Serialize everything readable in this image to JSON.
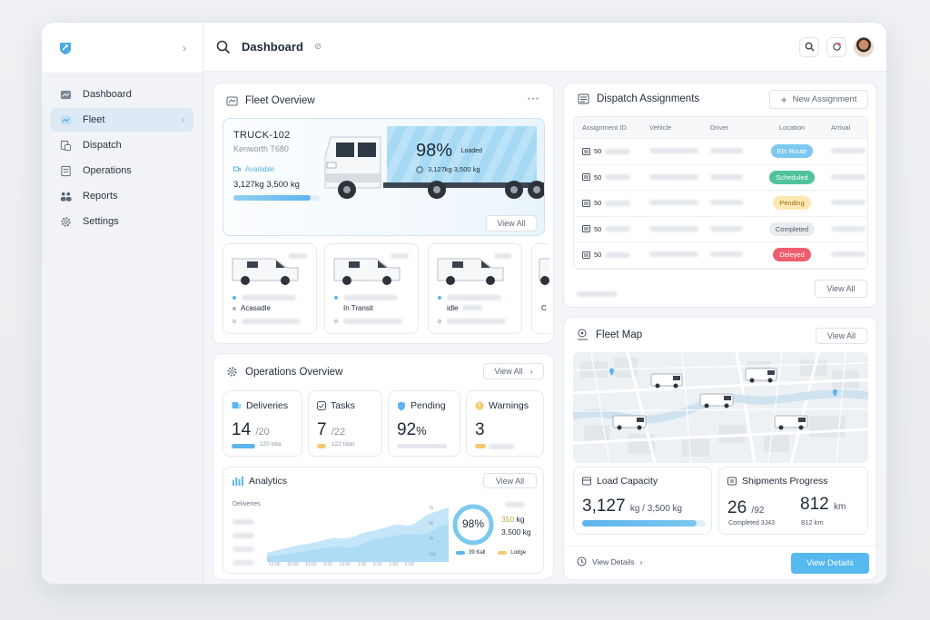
{
  "app": {
    "title": "Dashboard"
  },
  "sidebar": {
    "items": [
      {
        "label": "Dashboard",
        "icon": "dashboard-icon"
      },
      {
        "label": "Fleet",
        "icon": "fleet-icon",
        "active": true
      },
      {
        "label": "Dispatch",
        "icon": "dispatch-icon"
      },
      {
        "label": "Operations",
        "icon": "operations-icon"
      },
      {
        "label": "Reports",
        "icon": "reports-icon"
      },
      {
        "label": "Settings",
        "icon": "gear-icon"
      }
    ]
  },
  "fleet_overview": {
    "title": "Fleet Overview",
    "hero": {
      "truck_id": "TRUCK-102",
      "model": "Kenworth T680",
      "status": "Available",
      "capacity": "3,127kg 3,500 kg",
      "load_percent": "98%",
      "load_label": "Loaded",
      "load_capacity": "3,127kg 3,500 kg",
      "view_all": "View All",
      "progress": 0.89
    },
    "vans": [
      {
        "status": "Acasadle"
      },
      {
        "status": "In Transit"
      },
      {
        "status": "idle"
      },
      {
        "status": "C"
      }
    ]
  },
  "operations": {
    "title": "Operations Overview",
    "view_all": "View All",
    "stats": [
      {
        "label": "Deliveries",
        "value": "14",
        "total": "/20",
        "sub": "120 tota",
        "bar_color": "#5db4ee"
      },
      {
        "label": "Tasks",
        "value": "7",
        "total": "/22",
        "sub": "122 total",
        "bar_color": "#f5c971"
      },
      {
        "label": "Pending",
        "value": "92",
        "total": "%",
        "sub": "",
        "bar_color": "#e3e7ec"
      },
      {
        "label": "Warnings",
        "value": "3",
        "total": "",
        "sub": "",
        "bar_color": "#f5c971"
      }
    ],
    "analytics": {
      "title": "Analytics",
      "view_all": "View All",
      "series_label": "Deliveries",
      "gauge_value": "98%",
      "gauge_fraction": 0.98,
      "weight_main": "350",
      "weight_unit": "kg",
      "weight_total": "3,500 kg",
      "legend_a": "39 Kall",
      "legend_b": "Lodge",
      "x_ticks": [
        "12:00",
        "10:00",
        "13:00",
        "3:00",
        "13:00",
        "1:00",
        "5:00",
        "1:00",
        "2:0S"
      ],
      "y_ticks": [
        "7k",
        "5k",
        "3k",
        "40p"
      ]
    }
  },
  "dispatch": {
    "title": "Dispatch Assignments",
    "new_button": "New Assignment",
    "columns": [
      "Assignment ID",
      "Vehicle",
      "Driver",
      "Location",
      "Arrival"
    ],
    "rows": [
      {
        "id": "50",
        "location": "Eln Route",
        "bg": "#7cc8f0",
        "fg": "#ffffff"
      },
      {
        "id": "50",
        "location": "Scheduled",
        "bg": "#4fc39a",
        "fg": "#ffffff"
      },
      {
        "id": "50",
        "location": "Pending",
        "bg": "#fde8b4",
        "fg": "#9a6a12"
      },
      {
        "id": "50",
        "location": "Completed",
        "bg": "#e9ecef",
        "fg": "#4b5563"
      },
      {
        "id": "50",
        "location": "Deleyed",
        "bg": "#ee5e6e",
        "fg": "#ffffff"
      }
    ],
    "view_all": "View All"
  },
  "fleet_map": {
    "title": "Fleet Map",
    "view_all": "View All",
    "load_capacity": {
      "title": "Load Capacity",
      "value": "3,127",
      "unit": "kg / 3,500 kg",
      "progress": 0.93
    },
    "shipments": {
      "title": "Shipments Progress",
      "done": "26",
      "total": "/92",
      "done_label": "Completed 3J43",
      "distance": "812",
      "distance_unit": "km",
      "distance_sub": "812 km"
    },
    "view_details_link": "View Details",
    "view_details_button": "View Details"
  }
}
